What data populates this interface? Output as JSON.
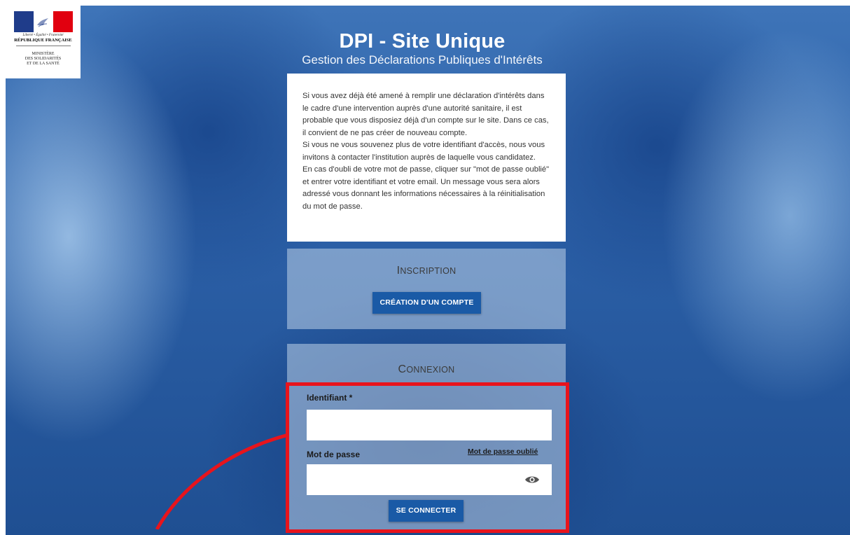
{
  "logo": {
    "motto": "Liberté • Égalité • Fraternité",
    "country": "RÉPUBLIQUE FRANÇAISE",
    "ministry_line1": "MINISTÈRE",
    "ministry_line2": "DES SOLIDARITÉS",
    "ministry_line3": "ET DE LA SANTÉ"
  },
  "header": {
    "title": "DPI - Site Unique",
    "subtitle": "Gestion des Déclarations Publiques d'Intérêts"
  },
  "info": {
    "paragraph1": "Si vous avez déjà été amené à remplir une déclaration d'intérêts dans le cadre d'une intervention auprès d'une autorité sanitaire, il est probable que vous disposiez déjà d'un compte sur le site. Dans ce cas, il convient de ne pas créer de nouveau compte.",
    "paragraph2": "Si vous ne vous souvenez plus de votre identifiant d'accès, nous vous invitons à contacter l'institution auprès de laquelle vous candidatez.",
    "paragraph3": "En cas d'oubli de votre mot de passe, cliquer sur \"mot de passe oublié\" et entrer votre identifiant et votre email. Un message vous sera alors adressé vous donnant les informations nécessaires à la réinitialisation du mot de passe."
  },
  "inscription": {
    "heading_initial": "I",
    "heading_rest": "NSCRIPTION",
    "button_label": "CRÉATION D'UN COMPTE"
  },
  "connexion": {
    "heading_initial": "C",
    "heading_rest": "ONNEXION",
    "identifiant_label": "Identifiant *",
    "identifiant_value": "",
    "password_label": "Mot de passe",
    "password_value": "",
    "forgot_label": "Mot de passe oublié",
    "login_button_label": "SE CONNECTER"
  },
  "colors": {
    "primary_button": "#1a5aa6",
    "highlight": "#e8141c"
  },
  "icons": [
    "eye-icon",
    "marianne-logo"
  ]
}
